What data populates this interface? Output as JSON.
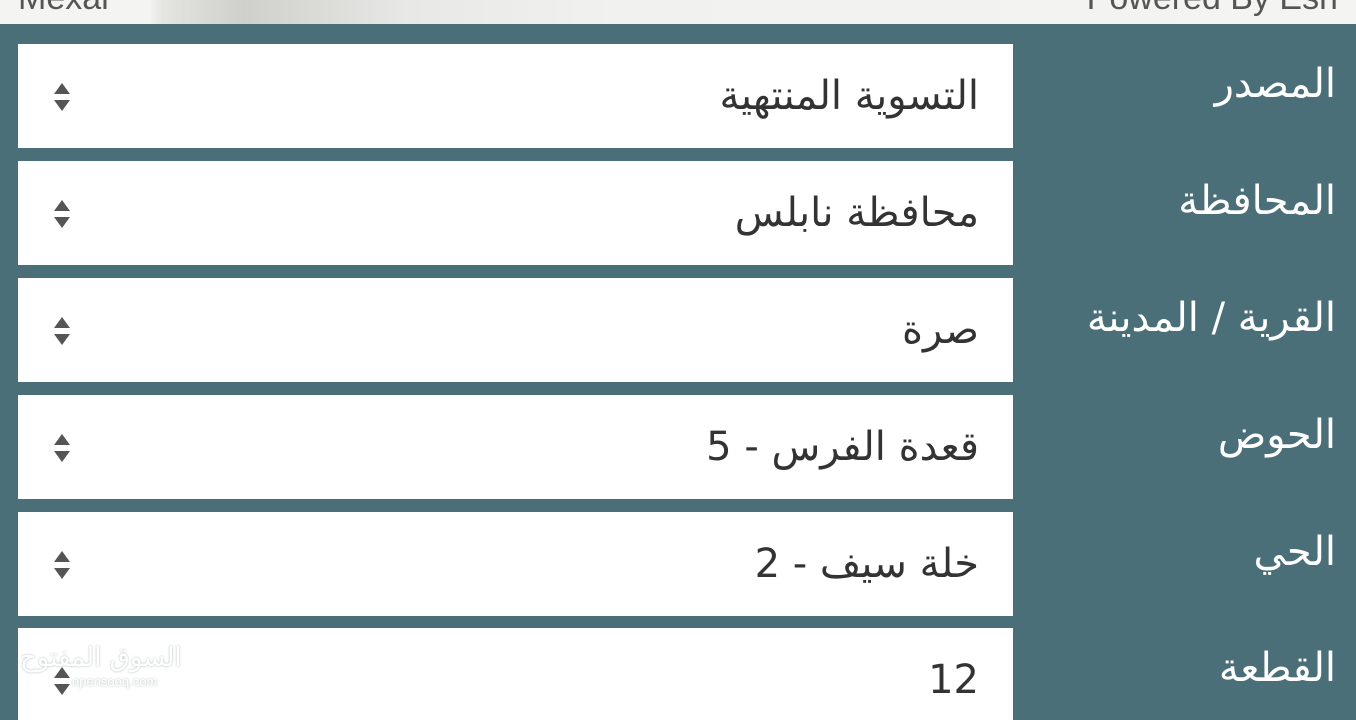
{
  "header": {
    "brand": "Mexar",
    "powered_by": "Powered By Esri"
  },
  "form": {
    "fields": [
      {
        "label": "المصدر",
        "value": "التسوية المنتهية"
      },
      {
        "label": "المحافظة",
        "value": "محافظة نابلس"
      },
      {
        "label": "القرية / المدينة",
        "value": "صرة"
      },
      {
        "label": "الحوض",
        "value": "قعدة الفرس - 5"
      },
      {
        "label": "الحي",
        "value": "خلة سيف - 2"
      },
      {
        "label": "القطعة",
        "value": "12"
      }
    ]
  },
  "watermark": {
    "arabic": "السوق المفتوح",
    "latin": "opensooq.com"
  },
  "colors": {
    "panel_background": "#4b6f78",
    "field_background": "#ffffff",
    "label_text": "#ffffff",
    "value_text": "#333333"
  },
  "icons": {
    "select_control": "up-down-arrows-icon"
  }
}
